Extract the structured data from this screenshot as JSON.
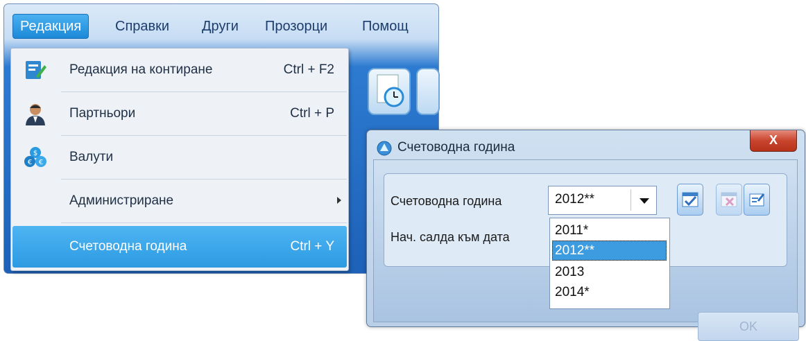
{
  "menubar": {
    "items": [
      "Редакция",
      "Справки",
      "Други",
      "Прозорци",
      "Помощ"
    ]
  },
  "dropdown": {
    "items": [
      {
        "label": "Редакция на контиране",
        "shortcut": "Ctrl + F2",
        "icon": "edit-document-icon"
      },
      {
        "label": "Партньори",
        "shortcut": "Ctrl + P",
        "icon": "person-icon"
      },
      {
        "label": "Валути",
        "shortcut": "",
        "icon": "coins-icon"
      },
      {
        "label": "Администриране",
        "shortcut": "",
        "icon": "",
        "submenu": true
      },
      {
        "label": "Счетоводна година",
        "shortcut": "Ctrl + Y",
        "icon": "",
        "highlighted": true
      }
    ]
  },
  "dialog": {
    "title": "Счетоводна година",
    "close_label": "X",
    "fiscal_year_label": "Счетоводна година",
    "opening_balance_label": "Нач. салда към дата",
    "combo_value": "2012**",
    "options": [
      "2011*",
      "2012**",
      "2013",
      "2014*"
    ],
    "selected_option": "2012**",
    "ok_label": "OK"
  }
}
